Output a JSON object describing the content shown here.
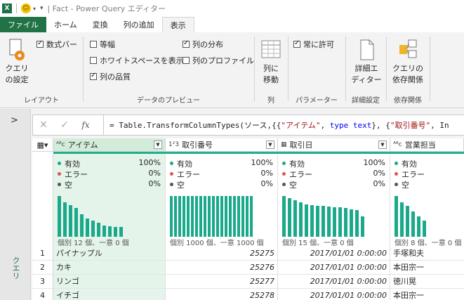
{
  "title_bar": {
    "app_icon": "X",
    "title": "| Fact - Power Query エディター"
  },
  "tabs": [
    "ファイル",
    "ホーム",
    "変換",
    "列の追加",
    "表示"
  ],
  "ribbon": {
    "query_settings": "クエリ\nの設定",
    "formula_bar": "数式バー",
    "monospace": "等幅",
    "show_whitespace": "ホワイトスペースを表示",
    "column_quality": "列の品質",
    "column_distribution": "列の分布",
    "column_profile": "列のプロファイル",
    "go_to_column": "列に\n移動",
    "always_allow": "常に許可",
    "advanced_editor": "詳細エ\nディター",
    "query_dependencies": "クエリの\n依存関係",
    "groups": [
      "レイアウト",
      "データのプレビュー",
      "列",
      "パラメーター",
      "詳細設定",
      "依存関係"
    ]
  },
  "left_strip": {
    "label": "クエリ"
  },
  "formula": {
    "p1": "= Table.TransformColumnTypes(ソース,{{",
    "s1": "\"アイテム\"",
    "p2": ", ",
    "k1": "type text",
    "p3": "}, {",
    "s2": "\"取引番号\"",
    "p4": ", In"
  },
  "columns": [
    {
      "type_icon": "ᴬᴮc",
      "name": "アイテム",
      "valid": "100%",
      "error": "0%",
      "empty": "0%",
      "distinct": "個別 12 個、一意 0 個"
    },
    {
      "type_icon": "1²3",
      "name": "取引番号",
      "valid": "100%",
      "error": "0%",
      "empty": "0%",
      "distinct": "個別 1000 個、一意 1000 個"
    },
    {
      "type_icon": "▦",
      "name": "取引日",
      "valid": "100%",
      "error": "0%",
      "empty": "0%",
      "distinct": "個別 15 個、一意 0 個"
    },
    {
      "type_icon": "ᴬᴮc",
      "name": "営業担当",
      "valid": "",
      "error": "",
      "empty": "",
      "distinct": "個別 8 個、一意 0 個"
    }
  ],
  "quality_labels": {
    "valid": "有効",
    "error": "エラー",
    "empty": "空"
  },
  "quality_colors": {
    "valid": "#1aa98a",
    "error": "#e0554f",
    "empty": "#555555"
  },
  "histograms": [
    [
      1.0,
      0.85,
      0.78,
      0.7,
      0.55,
      0.45,
      0.4,
      0.35,
      0.28,
      0.25,
      0.24,
      0.24
    ],
    [
      1.0,
      1.0,
      1.0,
      1.0,
      1.0,
      1.0,
      1.0,
      1.0,
      1.0,
      1.0,
      1.0,
      1.0,
      1.0,
      1.0,
      1.0,
      1.0,
      1.0,
      1.0,
      1.0,
      1.0
    ],
    [
      1.0,
      0.95,
      0.9,
      0.85,
      0.8,
      0.78,
      0.76,
      0.75,
      0.74,
      0.73,
      0.72,
      0.7,
      0.68,
      0.65,
      0.5
    ],
    [
      1.0,
      0.85,
      0.75,
      0.62,
      0.5,
      0.4
    ]
  ],
  "rows": [
    {
      "n": "1",
      "item": "パイナップル",
      "id": "25275",
      "date": "2017/01/01 0:00:00",
      "rep": "手塚和夫"
    },
    {
      "n": "2",
      "item": "カキ",
      "id": "25276",
      "date": "2017/01/01 0:00:00",
      "rep": "本田宗一"
    },
    {
      "n": "3",
      "item": "リンゴ",
      "id": "25277",
      "date": "2017/01/01 0:00:00",
      "rep": "徳川晃"
    },
    {
      "n": "4",
      "item": "イチゴ",
      "id": "25278",
      "date": "2017/01/01 0:00:00",
      "rep": "本田宗一"
    }
  ]
}
